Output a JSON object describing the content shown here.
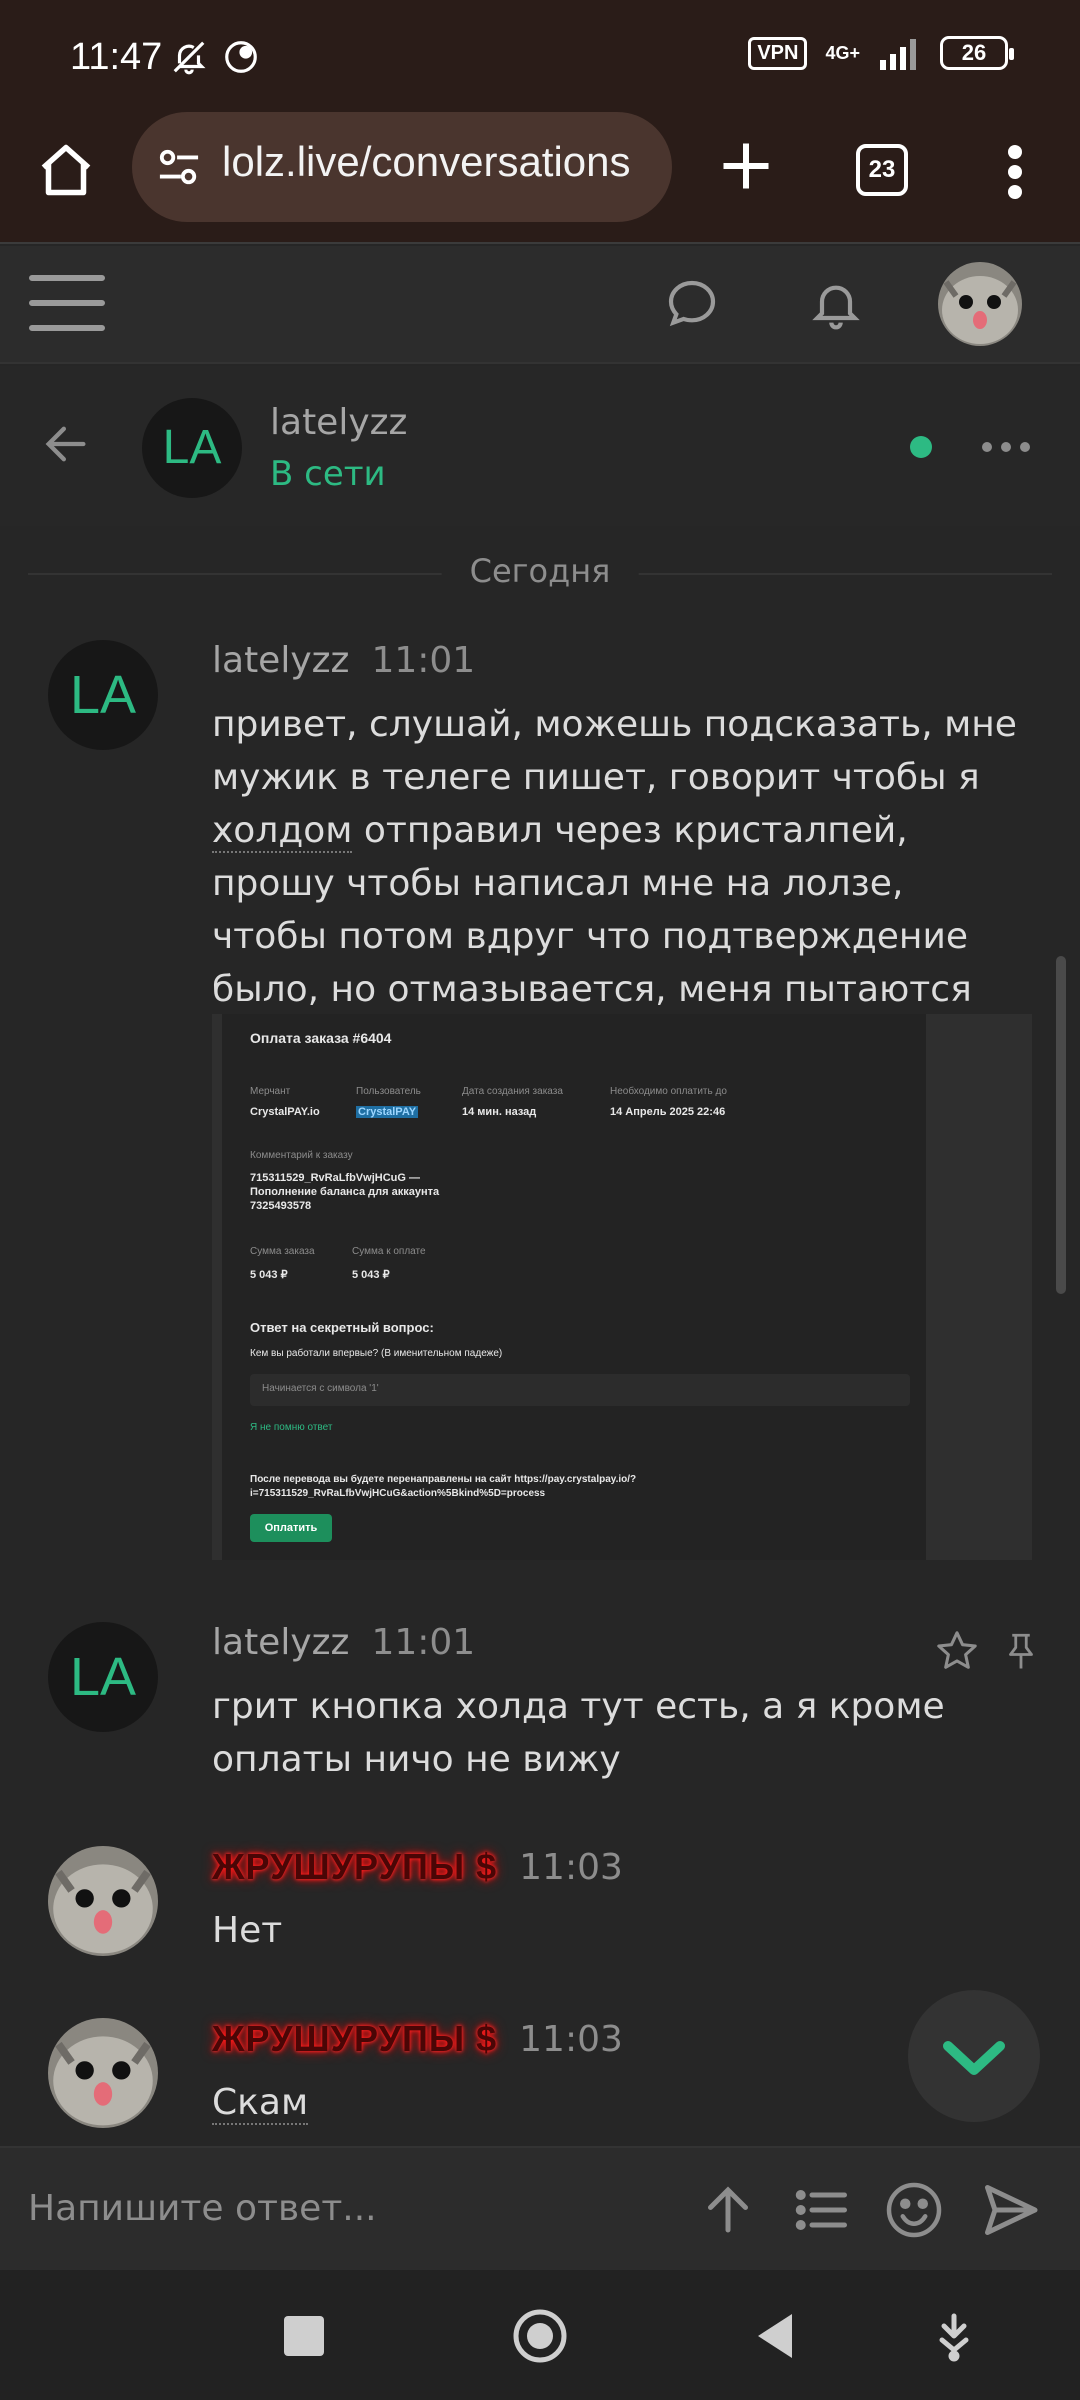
{
  "status_bar": {
    "time": "11:47",
    "vpn": "VPN",
    "network": "4G+",
    "battery": "26"
  },
  "browser": {
    "url": "lolz.live/conversations",
    "tab_count": "23"
  },
  "conversation": {
    "partner_initials": "LA",
    "partner_name": "latelyzz",
    "partner_status": "В сети",
    "day_separator": "Сегодня"
  },
  "messages": [
    {
      "author": "latelyzz",
      "initials": "LA",
      "time": "11:01",
      "line1": "привет, слушай, можешь подсказать, мне мужик в телеге пишет, говорит чтобы я ",
      "holdom": "холдом",
      "line2": " отправил через кристалпей, прошу чтобы написал мне на лолзе, чтобы потом вдруг что подтверждение было, но отмазывается, меня пытаются наебать?"
    },
    {
      "author": "latelyzz",
      "initials": "LA",
      "time": "11:01",
      "text": "грит кнопка холда тут есть, а я кроме оплаты ничо не вижу"
    },
    {
      "author": "ЖРУШУРУПЫ",
      "author_suffix": "$",
      "time": "11:03",
      "text": "Нет"
    },
    {
      "author": "ЖРУШУРУПЫ",
      "author_suffix": "$",
      "time": "11:03",
      "text": "Скам"
    }
  ],
  "attachment": {
    "title": "Оплата заказа #6404",
    "merchant_label": "Мерчант",
    "merchant_value": "CrystalPAY.io",
    "user_label": "Пользователь",
    "user_value": "CrystalPAY",
    "created_label": "Дата создания заказа",
    "created_value": "14 мин. назад",
    "due_label": "Необходимо оплатить до",
    "due_value": "14 Апрель 2025 22:46",
    "comment_label": "Комментарий к заказу",
    "comment_line1": "715311529_RvRaLfbVwjHCuG —",
    "comment_line2": "Пополнение баланса для аккаунта",
    "comment_line3": "7325493578",
    "order_sum_label": "Сумма заказа",
    "order_sum_value": "5 043 ₽",
    "pay_sum_label": "Сумма к оплате",
    "pay_sum_value": "5 043 ₽",
    "secret_title": "Ответ на секретный вопрос:",
    "secret_question": "Кем вы работали впервые? (В именительном падеже)",
    "secret_placeholder": "Начинается с символа '1'",
    "forgot": "Я не помню ответ",
    "redirect_line1": "После перевода вы будете перенаправлены на сайт https://pay.crystalpay.io/?",
    "redirect_line2": "i=715311529_RvRaLfbVwjHCuG&action%5Bkind%5D=process",
    "pay_button": "Оплатить"
  },
  "reply": {
    "placeholder": "Напишите ответ..."
  },
  "colors": {
    "background": "#262626",
    "accent_green": "#2dba83",
    "browser_bar": "#2a1c18",
    "url_pill": "#4a352e"
  }
}
